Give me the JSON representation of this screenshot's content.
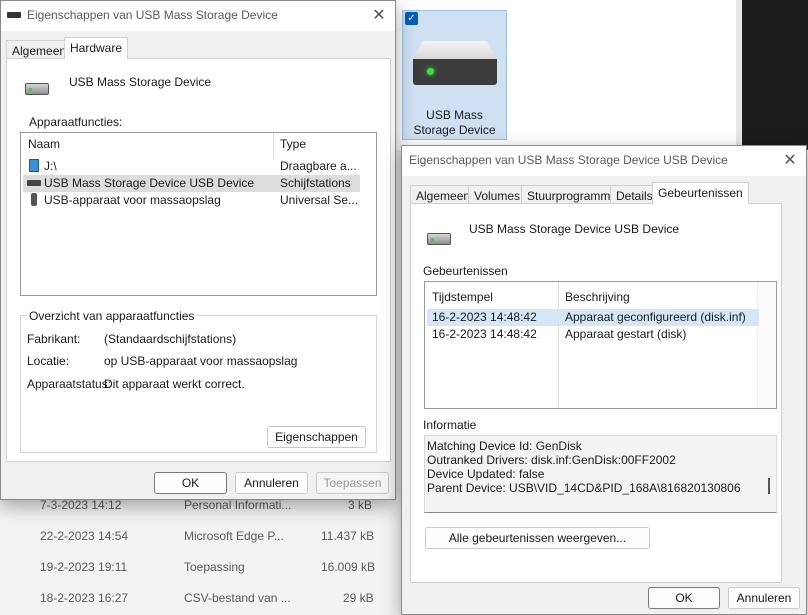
{
  "background": {
    "tile_label": "USB Mass\nStorage Device",
    "rows": [
      {
        "date": "7-3-2023 14:12",
        "type": "Personal Informati...",
        "size": "3 kB"
      },
      {
        "date": "22-2-2023 14:54",
        "type": "Microsoft Edge P...",
        "size": "11.437 kB"
      },
      {
        "date": "19-2-2023 19:11",
        "type": "Toepassing",
        "size": "16.009 kB"
      },
      {
        "date": "18-2-2023 16:27",
        "type": "CSV-bestand van ...",
        "size": "29 kB"
      }
    ]
  },
  "dialog1": {
    "title": "Eigenschappen van USB Mass Storage Device",
    "tabs": [
      "Algemeen",
      "Hardware"
    ],
    "device_name": "USB Mass Storage Device",
    "functions_label": "Apparaatfuncties:",
    "columns": [
      "Naam",
      "Type"
    ],
    "rows": [
      {
        "name": "J:\\",
        "type": "Draagbare a..."
      },
      {
        "name": "USB Mass  Storage Device USB Device",
        "type": "Schijfstations"
      },
      {
        "name": "USB-apparaat voor massaopslag",
        "type": "Universal Se..."
      }
    ],
    "overview_label": "Overzicht van apparaatfuncties",
    "manufacturer_label": "Fabrikant:",
    "manufacturer_value": "(Standaardschijfstations)",
    "location_label": "Locatie:",
    "location_value": "op USB-apparaat voor massaopslag",
    "status_label": "Apparaatstatus:",
    "status_value": "Dit apparaat werkt correct.",
    "properties_button": "Eigenschappen",
    "ok": "OK",
    "cancel": "Annuleren",
    "apply": "Toepassen"
  },
  "dialog2": {
    "title": "Eigenschappen van USB Mass  Storage Device USB Device",
    "tabs": [
      "Algemeen",
      "Volumes",
      "Stuurprogramma",
      "Details",
      "Gebeurtenissen"
    ],
    "device_name": "USB Mass  Storage Device USB Device",
    "events_label": "Gebeurtenissen",
    "columns": [
      "Tijdstempel",
      "Beschrijving"
    ],
    "events": [
      {
        "time": "16-2-2023 14:48:42",
        "desc": "Apparaat geconfigureerd (disk.inf)"
      },
      {
        "time": "16-2-2023 14:48:42",
        "desc": "Apparaat gestart (disk)"
      }
    ],
    "info_label": "Informatie",
    "info_lines": [
      "Matching Device Id: GenDisk",
      "Outranked Drivers: disk.inf:GenDisk:00FF2002",
      "Device Updated: false",
      "Parent Device: USB\\VID_14CD&PID_168A\\816820130806"
    ],
    "show_all_button": "Alle gebeurtenissen weergeven...",
    "ok": "OK",
    "cancel": "Annuleren"
  }
}
